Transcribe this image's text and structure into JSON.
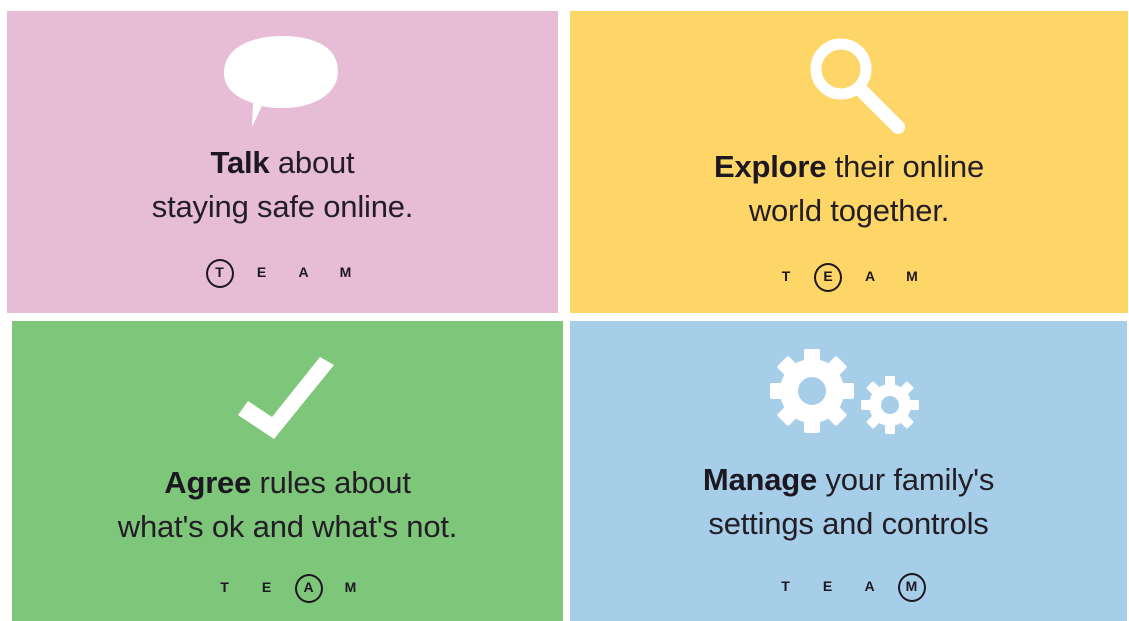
{
  "cards": [
    {
      "keyword": "Talk",
      "line1_rest": " about",
      "line2": "staying safe online.",
      "team": [
        "T",
        "E",
        "A",
        "M"
      ],
      "highlight_index": 0,
      "icon": "speech-bubble-icon",
      "color": "#e6bcd6"
    },
    {
      "keyword": "Explore",
      "line1_rest": " their online",
      "line2": "world together.",
      "team": [
        "T",
        "E",
        "A",
        "M"
      ],
      "highlight_index": 1,
      "icon": "magnifying-glass-icon",
      "color": "#fdd667"
    },
    {
      "keyword": "Agree",
      "line1_rest": " rules about",
      "line2": "what's ok and what's not.",
      "team": [
        "T",
        "E",
        "A",
        "M"
      ],
      "highlight_index": 2,
      "icon": "checkmark-icon",
      "color": "#7ec77a"
    },
    {
      "keyword": "Manage",
      "line1_rest": " your family's",
      "line2": "settings and controls",
      "team": [
        "T",
        "E",
        "A",
        "M"
      ],
      "highlight_index": 3,
      "icon": "gears-icon",
      "color": "#a7cee8"
    }
  ]
}
